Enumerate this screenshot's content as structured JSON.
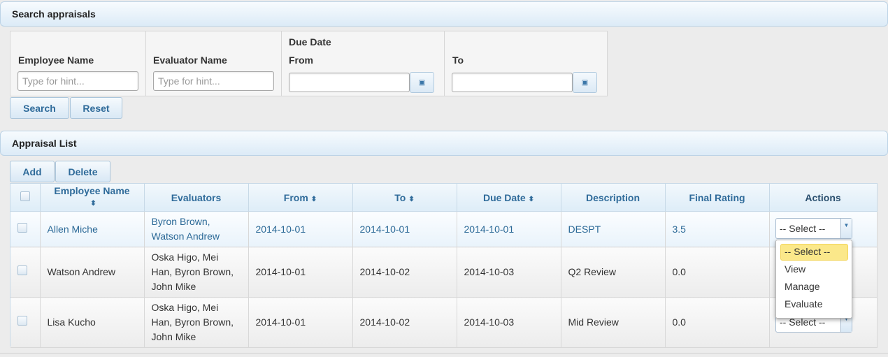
{
  "search_panel": {
    "title": "Search appraisals",
    "employee_name_label": "Employee Name",
    "employee_name_placeholder": "Type for hint...",
    "evaluator_name_label": "Evaluator Name",
    "evaluator_name_placeholder": "Type for hint...",
    "due_date_label": "Due Date",
    "from_label": "From",
    "to_label": "To",
    "from_value": "",
    "to_value": "",
    "search_button": "Search",
    "reset_button": "Reset"
  },
  "list_panel": {
    "title": "Appraisal List",
    "add_button": "Add",
    "delete_button": "Delete",
    "columns": [
      "Employee Name",
      "Evaluators",
      "From",
      "To",
      "Due Date",
      "Description",
      "Final Rating",
      "Actions"
    ],
    "sort_icon": "sort-arrows-icon",
    "rows": [
      {
        "employee": "Allen Miche",
        "evaluators": "Byron Brown, Watson Andrew",
        "from": "2014-10-01",
        "to": "2014-10-01",
        "due": "2014-10-01",
        "description": "DESPT",
        "rating": "3.5",
        "action": "-- Select --"
      },
      {
        "employee": "Watson Andrew",
        "evaluators": "Oska Higo, Mei Han, Byron Brown, John Mike",
        "from": "2014-10-01",
        "to": "2014-10-02",
        "due": "2014-10-03",
        "description": "Q2 Review",
        "rating": "0.0",
        "action": "-- Select --"
      },
      {
        "employee": "Lisa Kucho",
        "evaluators": "Oska Higo, Mei Han, Byron Brown, John Mike",
        "from": "2014-10-01",
        "to": "2014-10-02",
        "due": "2014-10-03",
        "description": "Mid Review",
        "rating": "0.0",
        "action": "-- Select --"
      }
    ]
  },
  "action_dropdown": {
    "options": [
      "-- Select --",
      "View",
      "Manage",
      "Evaluate"
    ],
    "highlighted": "-- Select --"
  },
  "colors": {
    "header_text": "#2f6b9a",
    "highlight": "#fbe88a"
  }
}
